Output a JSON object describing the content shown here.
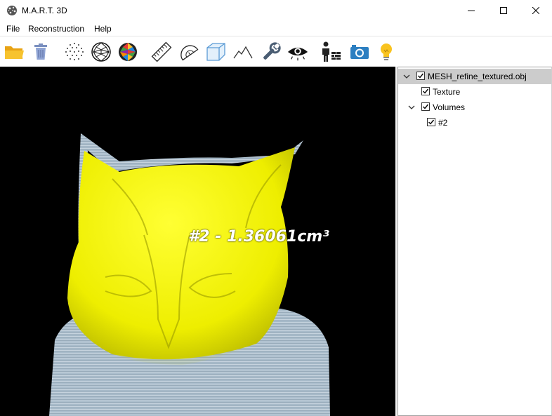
{
  "window": {
    "title": "M.A.R.T. 3D"
  },
  "menu": {
    "items": [
      "File",
      "Reconstruction",
      "Help"
    ]
  },
  "toolbar": {
    "icons": [
      "open-folder-icon",
      "trash-icon",
      "point-cloud-icon",
      "wireframe-sphere-icon",
      "textured-sphere-icon",
      "ruler-icon",
      "protractor-icon",
      "box-icon",
      "terrain-icon",
      "wrench-icon",
      "eye-icon",
      "builder-icon",
      "camera-icon",
      "lightbulb-icon"
    ]
  },
  "viewport": {
    "measurement_label": "#2 - 1.36061cm³",
    "colors": {
      "background": "#000000",
      "volume": "#f2f200",
      "mesh": "#a9bccb"
    }
  },
  "tree": {
    "items": [
      {
        "label": "MESH_refine_textured.obj",
        "checked": true,
        "expanded": true,
        "selected": true
      },
      {
        "label": "Texture",
        "checked": true
      },
      {
        "label": "Volumes",
        "checked": true,
        "expanded": true
      },
      {
        "label": "#2",
        "checked": true
      }
    ]
  }
}
